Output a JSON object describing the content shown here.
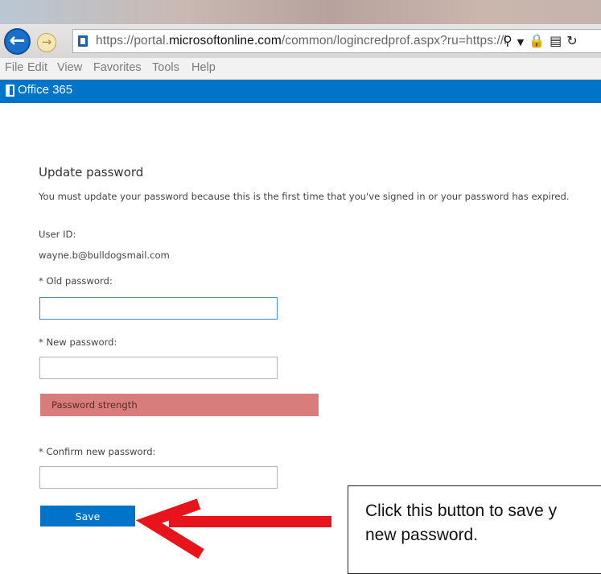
{
  "browser": {
    "url_prefix": "https://portal.",
    "url_domain": "microsoftonline.com",
    "url_rest": "/common/logincredprof.aspx?ru=https://l",
    "menu": [
      "File",
      "Edit",
      "View",
      "Favorites",
      "Tools",
      "Help"
    ],
    "address_icons": [
      "search-icon",
      "dropdown-icon",
      "lock-icon",
      "compat-icon",
      "refresh-icon"
    ]
  },
  "app": {
    "brand": "Office 365",
    "brand_color": "#0074c8"
  },
  "form": {
    "title": "Update password",
    "message": "You must update your password because this is the first time that you've signed in or your password has expired.",
    "user_id_label": "User ID:",
    "user_id_value": "wayne.b@bulldogsmail.com",
    "old_password_label": "* Old password:",
    "old_password_value": "",
    "new_password_label": "* New password:",
    "new_password_value": "",
    "strength_label": "Password strength",
    "strength_color": "#d87c7c",
    "confirm_password_label": "* Confirm new password:",
    "confirm_password_value": "",
    "save_label": "Save"
  },
  "annotation": {
    "callout_text": "Click this button to save y\nnew password.",
    "arrow_color": "#e8141b"
  }
}
